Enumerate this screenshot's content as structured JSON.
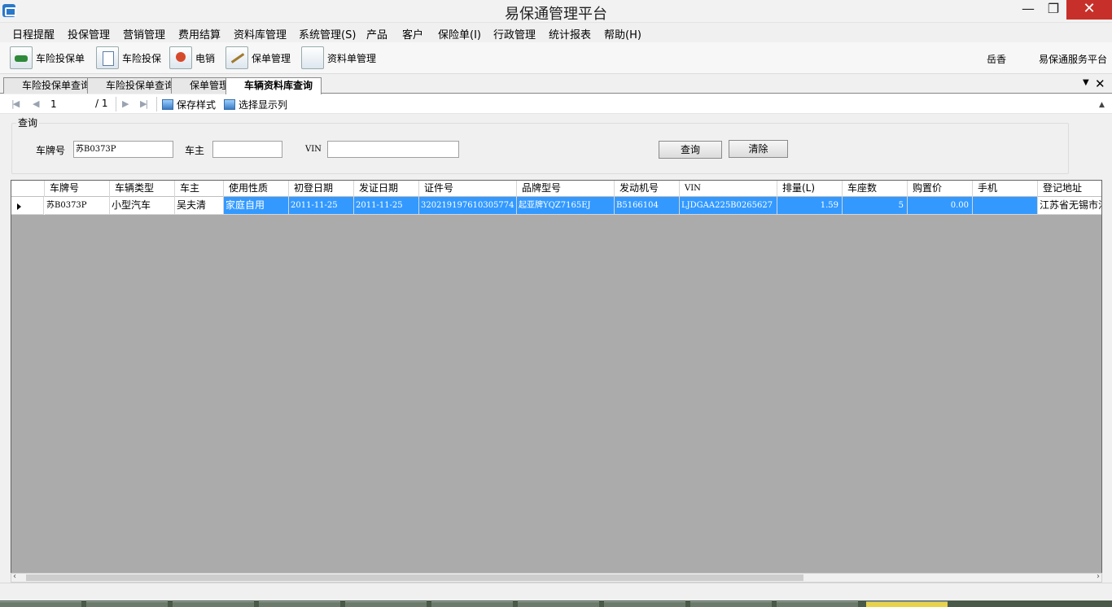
{
  "window": {
    "title": "易保通管理平台",
    "minimize": "—",
    "maximize": "❐",
    "close": "✕"
  },
  "menu": [
    "日程提醒",
    "投保管理",
    "营销管理",
    "费用结算",
    "资料库管理",
    "系统管理(S)",
    "产品",
    "客户",
    "保险单(I)",
    "行政管理",
    "统计报表",
    "帮助(H)"
  ],
  "toolbar": {
    "buttons": [
      {
        "label": "车险投保单",
        "icon": "car-document-icon"
      },
      {
        "label": "车险投保",
        "icon": "document-icon"
      },
      {
        "label": "电销",
        "icon": "phone-contact-icon"
      },
      {
        "label": "保单管理",
        "icon": "pen-document-icon"
      },
      {
        "label": "资料单管理",
        "icon": "blank-document-icon"
      }
    ],
    "user": "岳香",
    "platform": "易保通服务平台"
  },
  "tabs": [
    "车险投保单查询",
    "车险投保单查询",
    "保单管理",
    "车辆资料库查询"
  ],
  "tab_overflow": "▼",
  "tab_close": "✕",
  "navigator": {
    "first": "|◀",
    "prev": "◀",
    "page": "1",
    "total": "/ 1",
    "next": "▶",
    "last": "▶|",
    "save_style": "保存样式",
    "select_columns": "选择显示列"
  },
  "query": {
    "legend": "查询",
    "plate_label": "车牌号",
    "plate_value": "苏B0373P",
    "owner_label": "车主",
    "owner_value": "",
    "vin_label": "VIN",
    "vin_value": "",
    "search_button": "查询",
    "clear_button": "清除"
  },
  "grid": {
    "columns": [
      "车牌号",
      "车辆类型",
      "车主",
      "使用性质",
      "初登日期",
      "发证日期",
      "证件号",
      "品牌型号",
      "发动机号",
      "VIN",
      "排量(L)",
      "车座数",
      "购置价",
      "手机",
      "登记地址"
    ],
    "rows": [
      [
        "苏B0373P",
        "小型汽车",
        "吴夫清",
        "家庭自用",
        "2011-11-25",
        "2011-11-25",
        "320219197610305774",
        "起亚牌YQZ7165EJ",
        "B5166104",
        "LJDGAA225B0265627",
        "1.59",
        "5",
        "0.00",
        "",
        "江苏省无锡市江"
      ]
    ]
  },
  "colors": {
    "selection": "#3399ff",
    "grid_background": "#ababab",
    "close_button": "#c7302a"
  }
}
